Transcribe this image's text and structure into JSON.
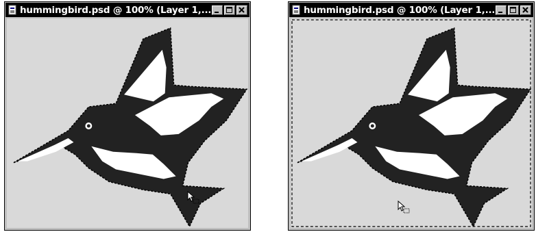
{
  "windows": [
    {
      "title": "hummingbird.psd @ 100% (Layer 1,...",
      "icons": {
        "document": "document-icon",
        "minimize": "minimize-icon",
        "maximize": "maximize-icon",
        "close": "close-icon"
      },
      "canvas_selection": "bird-only",
      "cursor": "move-selection-cursor"
    },
    {
      "title": "hummingbird.psd @ 100% (Layer 1,...",
      "icons": {
        "document": "document-icon",
        "minimize": "minimize-icon",
        "maximize": "maximize-icon",
        "close": "close-icon"
      },
      "canvas_selection": "bird-and-canvas-border",
      "cursor": "move-selection-cursor"
    }
  ],
  "colors": {
    "titlebar": "#000000",
    "canvas_bg": "#d9d9d9",
    "bird_dark": "#222222",
    "bird_light": "#ffffff",
    "window_chrome": "#c0c0c0"
  }
}
